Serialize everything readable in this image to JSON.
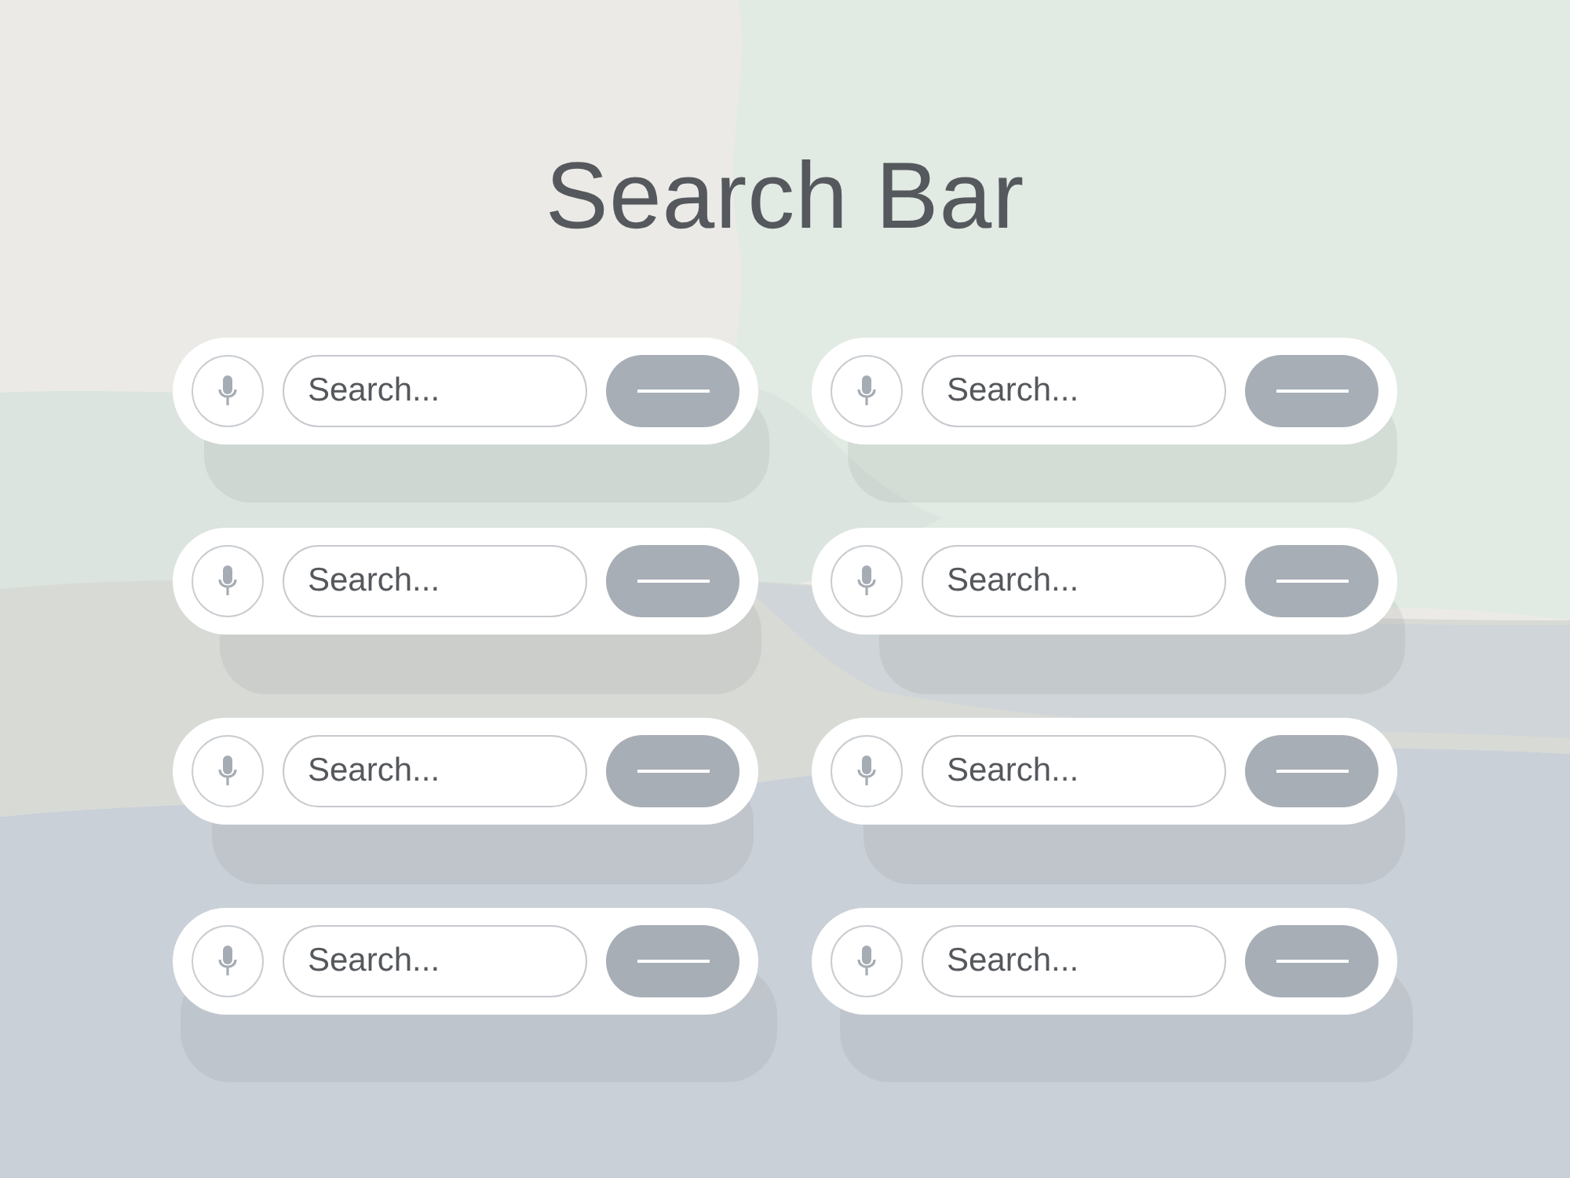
{
  "title": "Search Bar",
  "search_bars": [
    {
      "placeholder": "Search..."
    },
    {
      "placeholder": "Search..."
    },
    {
      "placeholder": "Search..."
    },
    {
      "placeholder": "Search..."
    },
    {
      "placeholder": "Search..."
    },
    {
      "placeholder": "Search..."
    },
    {
      "placeholder": "Search..."
    },
    {
      "placeholder": "Search..."
    }
  ]
}
